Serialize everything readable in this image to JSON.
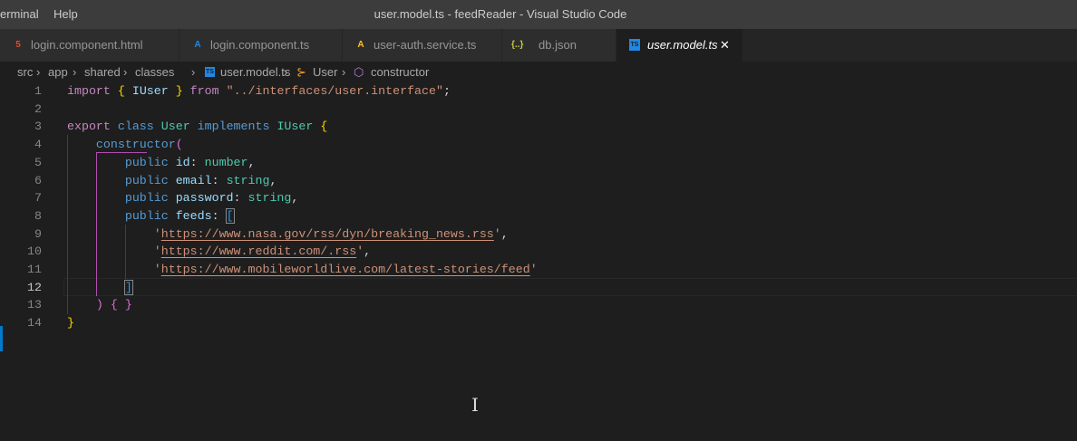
{
  "menu": [
    "erminal",
    "Help"
  ],
  "window_title": "user.model.ts - feedReader - Visual Studio Code",
  "tabs": [
    {
      "label": "login.component.html",
      "icon": "html5-icon",
      "glyph": "5",
      "color": "#e34c26"
    },
    {
      "label": "login.component.ts",
      "icon": "angular-icon",
      "glyph": "A",
      "color": "#1e88e5"
    },
    {
      "label": "user-auth.service.ts",
      "icon": "angular-service-icon",
      "glyph": "A",
      "color": "#fbc02d"
    },
    {
      "label": "db.json",
      "icon": "json-icon",
      "glyph": "{..}",
      "color": "#cbcb41"
    },
    {
      "label": "user.model.ts",
      "icon": "typescript-icon",
      "glyph": "TS",
      "color": "#1e88e5",
      "active": true
    }
  ],
  "breadcrumbs": [
    "src",
    "app",
    "shared",
    "classes",
    "user.model.ts",
    "User",
    "constructor"
  ],
  "current_line": 12,
  "lines": [
    [
      [
        "import",
        "kw"
      ],
      [
        " ",
        "pu"
      ],
      [
        "{",
        "br1"
      ],
      [
        " IUser ",
        "id"
      ],
      [
        "}",
        "br1"
      ],
      [
        " from ",
        "kw"
      ],
      [
        "\"../interfaces/user.interface\"",
        "st"
      ],
      [
        ";",
        "pu"
      ]
    ],
    [],
    [
      [
        "export",
        "kw"
      ],
      [
        " class ",
        "kb"
      ],
      [
        "User",
        "ty"
      ],
      [
        " implements ",
        "kb"
      ],
      [
        "IUser",
        "ty"
      ],
      [
        " ",
        "pu"
      ],
      [
        "{",
        "br1"
      ]
    ],
    [
      [
        "    ",
        "pu"
      ],
      [
        "constructor",
        "kb"
      ],
      [
        "(",
        "br2"
      ]
    ],
    [
      [
        "        public ",
        "kb"
      ],
      [
        "id",
        "id"
      ],
      [
        ": ",
        "pu"
      ],
      [
        "number",
        "ty"
      ],
      [
        ",",
        "pu"
      ]
    ],
    [
      [
        "        public ",
        "kb"
      ],
      [
        "email",
        "id"
      ],
      [
        ": ",
        "pu"
      ],
      [
        "string",
        "ty"
      ],
      [
        ",",
        "pu"
      ]
    ],
    [
      [
        "        public ",
        "kb"
      ],
      [
        "password",
        "id"
      ],
      [
        ": ",
        "pu"
      ],
      [
        "string",
        "ty"
      ],
      [
        ",",
        "pu"
      ]
    ],
    [
      [
        "        public ",
        "kb"
      ],
      [
        "feeds",
        "id"
      ],
      [
        ": ",
        "pu"
      ],
      [
        "[",
        "br3"
      ]
    ],
    [
      [
        "            '",
        "st"
      ],
      [
        "https://www.nasa.gov/rss/dyn/breaking_news.rss",
        "st url"
      ],
      [
        "'",
        "st"
      ],
      [
        ",",
        "pu"
      ]
    ],
    [
      [
        "            '",
        "st"
      ],
      [
        "https://www.reddit.com/.rss",
        "st url"
      ],
      [
        "'",
        "st"
      ],
      [
        ",",
        "pu"
      ]
    ],
    [
      [
        "            '",
        "st"
      ],
      [
        "https://www.mobileworldlive.com/latest-stories/feed",
        "st url"
      ],
      [
        "'",
        "st"
      ]
    ],
    [
      [
        "        ",
        "pu"
      ],
      [
        "]",
        "br3"
      ]
    ],
    [
      [
        "    ",
        "pu"
      ],
      [
        ")",
        "br2"
      ],
      [
        " ",
        "pu"
      ],
      [
        "{",
        "br2"
      ],
      [
        " ",
        "pu"
      ],
      [
        "}",
        "br2"
      ]
    ],
    [
      [
        "}",
        "br1"
      ]
    ]
  ]
}
